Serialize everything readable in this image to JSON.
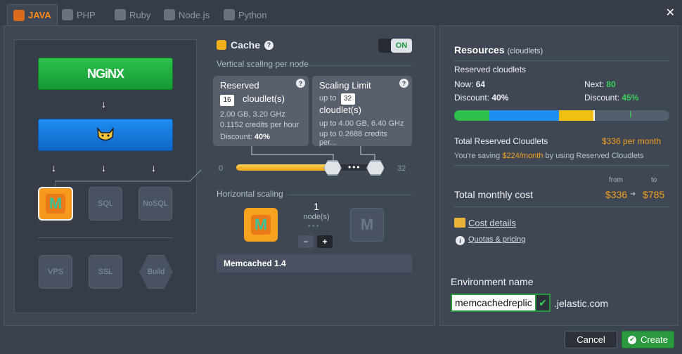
{
  "tabs": [
    {
      "label": "JAVA",
      "active": true,
      "icon": "java-icon"
    },
    {
      "label": "PHP",
      "active": false,
      "icon": "php-icon"
    },
    {
      "label": "Ruby",
      "active": false,
      "icon": "ruby-icon"
    },
    {
      "label": "Node.js",
      "active": false,
      "icon": "nodejs-icon"
    },
    {
      "label": "Python",
      "active": false,
      "icon": "python-icon"
    }
  ],
  "topology": {
    "balancer_label": "NGiNX",
    "node_sql": "SQL",
    "node_nosql": "NoSQL",
    "node_vps": "VPS",
    "node_ssl": "SSL",
    "node_build": "Build"
  },
  "cache": {
    "title": "Cache",
    "toggle": "ON",
    "vertical_label": "Vertical scaling per node",
    "reserved": {
      "title": "Reserved",
      "value": "16",
      "unit": "cloudlet(s)",
      "spec": "2.00 GB, 3.20 GHz",
      "credits": "0.1152 credits per hour",
      "discount_label": "Discount:",
      "discount_value": "40%"
    },
    "limit": {
      "title": "Scaling Limit",
      "prefix": "up to",
      "value": "32",
      "unit": "cloudlet(s)",
      "spec_prefix": "up to",
      "spec": "4.00 GB, 6.40 GHz",
      "credits_prefix": "up to",
      "credits": "0.2688 credits per..."
    },
    "slider_min": "0",
    "slider_max": "32",
    "horizontal_label": "Horizontal scaling",
    "node_count": "1",
    "node_unit": "node(s)",
    "minus": "−",
    "plus": "+",
    "version": "Memcached 1.4"
  },
  "resources": {
    "title": "Resources",
    "title_unit": "(cloudlets)",
    "reserved_heading": "Reserved cloudlets",
    "now_label": "Now:",
    "now_value": "64",
    "next_label": "Next:",
    "next_value": "80",
    "discount_label": "Discount:",
    "discount_now": "40%",
    "discount_next": "45%",
    "total_reserved_label": "Total Reserved Cloudlets",
    "total_reserved_value": "$336 per month",
    "saving_prefix": "You're saving",
    "saving_value": "$224/month",
    "saving_suffix": "by using Reserved Cloudlets",
    "from_label": "from",
    "to_label": "to",
    "total_monthly_label": "Total monthly cost",
    "cost_from": "$336",
    "cost_to": "$785",
    "cost_details": "Cost details",
    "quotas": "Quotas & pricing"
  },
  "env": {
    "label": "Environment name",
    "value": "memcachedreplic",
    "domain": ".jelastic.com"
  },
  "footer": {
    "cancel": "Cancel",
    "create": "Create"
  },
  "colors": {
    "accent_orange": "#f4a11e",
    "accent_green": "#3bd05a",
    "accent_blue": "#1e8ef0"
  }
}
